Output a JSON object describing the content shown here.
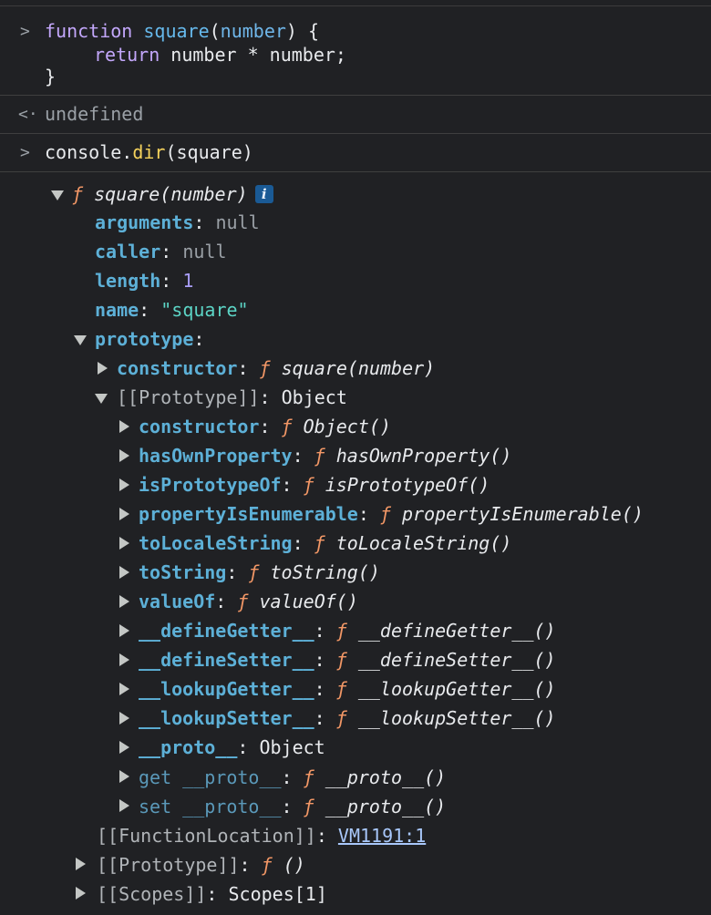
{
  "input1": {
    "prompt": ">",
    "line1": {
      "kw": "function",
      "name": "square",
      "open": "(",
      "param": "number",
      "close": ") {"
    },
    "line2": {
      "kw": "return",
      "expr": "number * number;"
    },
    "line3": "}"
  },
  "result1": {
    "prompt": "<·",
    "value": "undefined"
  },
  "input2": {
    "prompt": ">",
    "obj": "console.",
    "method": "dir",
    "args": "(square)"
  },
  "tree": {
    "root": {
      "f": "ƒ",
      "sig": "square(number)",
      "info": "i"
    },
    "props": [
      {
        "key": "arguments",
        "value": "null"
      },
      {
        "key": "caller",
        "value": "null"
      },
      {
        "key": "length",
        "value": "1"
      },
      {
        "key": "name",
        "value": "\"square\""
      }
    ],
    "prototype": {
      "key": "prototype",
      "constructor": {
        "key": "constructor",
        "f": "ƒ",
        "sig": "square(number)"
      },
      "proto": {
        "key": "[[Prototype]]",
        "value": "Object"
      },
      "proto_members": [
        {
          "key": "constructor",
          "f": "ƒ",
          "sig": "Object()"
        },
        {
          "key": "hasOwnProperty",
          "f": "ƒ",
          "sig": "hasOwnProperty()"
        },
        {
          "key": "isPrototypeOf",
          "f": "ƒ",
          "sig": "isPrototypeOf()"
        },
        {
          "key": "propertyIsEnumerable",
          "f": "ƒ",
          "sig": "propertyIsEnumerable()"
        },
        {
          "key": "toLocaleString",
          "f": "ƒ",
          "sig": "toLocaleString()"
        },
        {
          "key": "toString",
          "f": "ƒ",
          "sig": "toString()"
        },
        {
          "key": "valueOf",
          "f": "ƒ",
          "sig": "valueOf()"
        },
        {
          "key": "__defineGetter__",
          "f": "ƒ",
          "sig": "__defineGetter__()"
        },
        {
          "key": "__defineSetter__",
          "f": "ƒ",
          "sig": "__defineSetter__()"
        },
        {
          "key": "__lookupGetter__",
          "f": "ƒ",
          "sig": "__lookupGetter__()"
        },
        {
          "key": "__lookupSetter__",
          "f": "ƒ",
          "sig": "__lookupSetter__()"
        },
        {
          "key": "__proto__",
          "value": "Object"
        },
        {
          "key": "get __proto__",
          "f": "ƒ",
          "sig": "__proto__()"
        },
        {
          "key": "set __proto__",
          "f": "ƒ",
          "sig": "__proto__()"
        }
      ]
    },
    "function_location": {
      "key": "[[FunctionLocation]]",
      "link": "VM1191:1"
    },
    "fn_prototype": {
      "key": "[[Prototype]]",
      "f": "ƒ",
      "sig": "()"
    },
    "scopes": {
      "key": "[[Scopes]]",
      "value": "Scopes[1]"
    }
  }
}
